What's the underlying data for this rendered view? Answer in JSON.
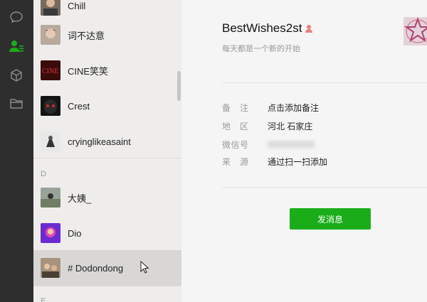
{
  "sidebar": {
    "nav": [
      {
        "icon": "chat-icon",
        "active": false
      },
      {
        "icon": "contacts-icon",
        "active": true
      },
      {
        "icon": "cube-icon",
        "active": false
      },
      {
        "icon": "folder-icon",
        "active": false
      }
    ]
  },
  "contacts": {
    "items": [
      {
        "name": "Chill"
      },
      {
        "name": "词不达意"
      },
      {
        "name": "CINE笑笑"
      },
      {
        "name": "Crest"
      },
      {
        "name": "cryinglikeasaint"
      },
      {
        "name": "大姨_"
      },
      {
        "name": "Dio"
      },
      {
        "name": "#   Dodondong"
      }
    ],
    "section_d": "D",
    "section_next": "E"
  },
  "profile": {
    "nickname": "BestWishes2st",
    "signature": "每天都是一个新的开始",
    "fields": [
      {
        "label": "备　注",
        "value": "点击添加备注"
      },
      {
        "label": "地　区",
        "value": "河北 石家庄"
      },
      {
        "label": "微信号",
        "value": ""
      },
      {
        "label": "来　源",
        "value": "通过扫一扫添加"
      }
    ],
    "send_button": "发消息"
  },
  "colors": {
    "accent": "#1aad19",
    "sidebar_bg": "#2e2e2e",
    "list_bg": "#eeedec",
    "selected_bg": "#d8d7d6",
    "gender_female": "#e8817c"
  }
}
